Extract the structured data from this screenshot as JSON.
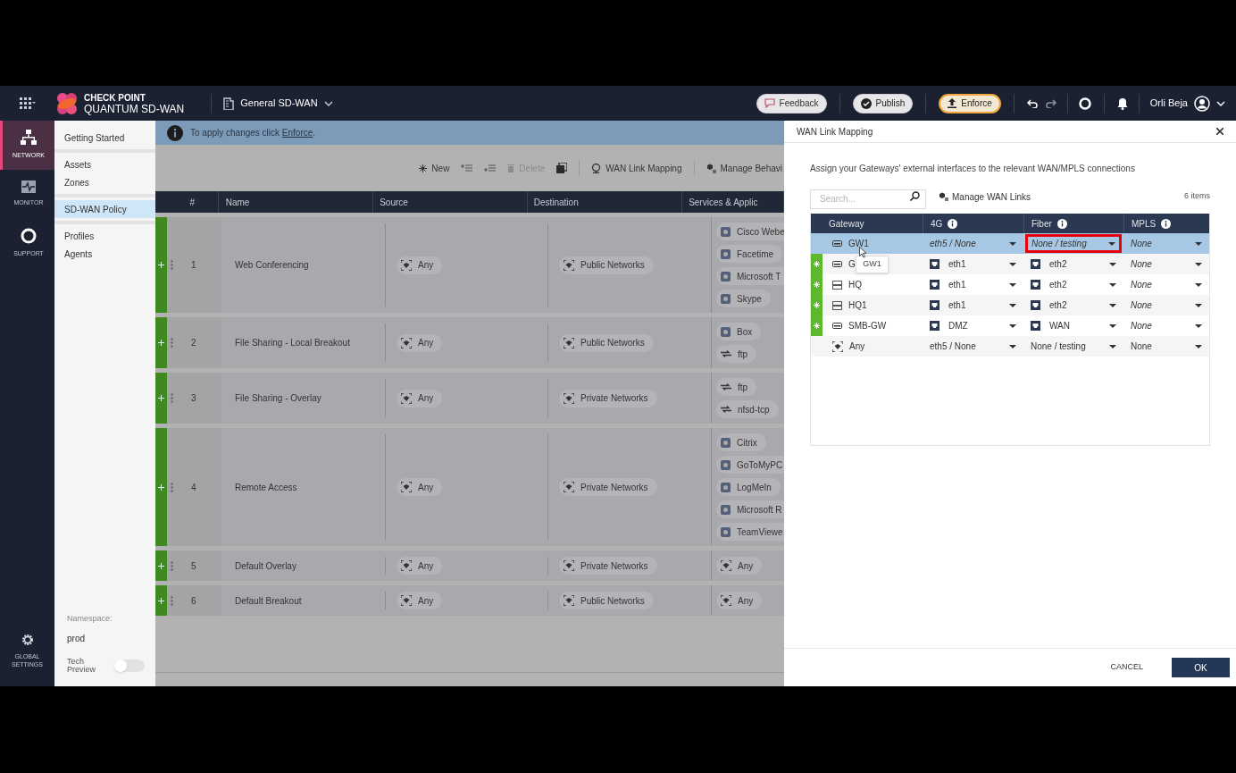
{
  "top_bar": {
    "brand_line1": "CHECK POINT",
    "brand_line2": "QUANTUM SD-WAN",
    "policy_selector": "General SD-WAN",
    "buttons": [
      {
        "kind": "feedback",
        "label": "Feedback"
      },
      {
        "kind": "publish",
        "label": "Publish"
      },
      {
        "kind": "enforce",
        "label": "Enforce"
      }
    ],
    "user": "Orli Beja"
  },
  "rail": {
    "items": [
      {
        "kind": "network",
        "label": "NETWORK",
        "selected": true
      },
      {
        "kind": "monitor",
        "label": "MONITOR",
        "selected": false
      },
      {
        "kind": "support",
        "label": "SUPPORT",
        "selected": false
      }
    ],
    "settings_label": "GLOBAL SETTINGS"
  },
  "subnav": {
    "groups": [
      [
        {
          "label": "Getting Started",
          "selected": false
        }
      ],
      [
        {
          "label": "Assets",
          "selected": false
        },
        {
          "label": "Zones",
          "selected": false
        }
      ],
      [
        {
          "label": "SD-WAN Policy",
          "selected": true
        }
      ],
      [
        {
          "label": "Profiles",
          "selected": false
        },
        {
          "label": "Agents",
          "selected": false
        }
      ]
    ],
    "namespace_label": "Namespace:",
    "namespace": "prod",
    "tech_preview_label": "Tech Preview",
    "tech_preview_on": false
  },
  "banner": {
    "text_before": "To apply changes click ",
    "link": "Enforce",
    "text_after": "."
  },
  "toolbar": [
    {
      "kind": "new",
      "label": "New",
      "disabled": false
    },
    {
      "kind": "add-above",
      "disabled": false
    },
    {
      "kind": "add-below",
      "disabled": false
    },
    {
      "kind": "delete",
      "label": "Delete",
      "disabled": true
    },
    {
      "kind": "clone",
      "disabled": false
    },
    {
      "kind": "separator"
    },
    {
      "kind": "wan",
      "label": "WAN Link Mapping",
      "disabled": false
    },
    {
      "kind": "separator"
    },
    {
      "kind": "behavior",
      "label": "Manage Behavi",
      "disabled": false
    }
  ],
  "policy_table": {
    "columns": [
      "#",
      "Name",
      "Source",
      "Destination",
      "Services & Applic"
    ],
    "rows": [
      {
        "new": true,
        "number": "1",
        "name": "Web Conferencing",
        "source": "Any",
        "destination": "Public Networks",
        "services": [
          {
            "kind": "app",
            "label": "Cisco Webe"
          },
          {
            "kind": "app",
            "label": "Facetime"
          },
          {
            "kind": "app",
            "label": "Microsoft T"
          },
          {
            "kind": "app",
            "label": "Skype"
          }
        ]
      },
      {
        "new": true,
        "number": "2",
        "name": "File Sharing - Local Breakout",
        "source": "Any",
        "destination": "Public Networks",
        "services": [
          {
            "kind": "app",
            "label": "Box"
          },
          {
            "kind": "service",
            "label": "ftp"
          }
        ]
      },
      {
        "new": true,
        "number": "3",
        "name": "File Sharing - Overlay",
        "source": "Any",
        "destination": "Private Networks",
        "services": [
          {
            "kind": "service",
            "label": "ftp"
          },
          {
            "kind": "service",
            "label": "nfsd-tcp"
          }
        ]
      },
      {
        "new": true,
        "number": "4",
        "name": "Remote Access",
        "source": "Any",
        "destination": "Private Networks",
        "services": [
          {
            "kind": "app",
            "label": "Citrix"
          },
          {
            "kind": "app",
            "label": "GoToMyPC"
          },
          {
            "kind": "app",
            "label": "LogMeIn"
          },
          {
            "kind": "app",
            "label": "Microsoft R"
          },
          {
            "kind": "app",
            "label": "TeamViewe"
          }
        ]
      },
      {
        "new": true,
        "number": "5",
        "name": "Default Overlay",
        "source": "Any",
        "destination": "Private Networks",
        "services": [
          {
            "kind": "any",
            "label": "Any"
          }
        ]
      },
      {
        "new": true,
        "number": "6",
        "name": "Default Breakout",
        "source": "Any",
        "destination": "Public Networks",
        "services": [
          {
            "kind": "any",
            "label": "Any"
          }
        ]
      }
    ]
  },
  "panel": {
    "title": "WAN Link Mapping",
    "description": "Assign your Gateways' external interfaces to the relevant WAN/MPLS connections",
    "search_placeholder": "Search...",
    "manage_button": "Manage WAN Links",
    "count": "6 items",
    "columns": [
      {
        "label": "Gateway",
        "info": false
      },
      {
        "label": "4G",
        "info": true
      },
      {
        "label": "Fiber",
        "info": true
      },
      {
        "label": "MPLS",
        "info": true
      }
    ],
    "rows": [
      {
        "selected": true,
        "new": false,
        "kind": "gateway",
        "gateway": "GW1",
        "cells": [
          {
            "text": "eth5 / None",
            "italic": true,
            "interface": false,
            "highlighted": false
          },
          {
            "text": "None / testing",
            "italic": true,
            "interface": false,
            "highlighted": true
          },
          {
            "text": "None",
            "italic": true,
            "interface": false,
            "highlighted": false
          }
        ]
      },
      {
        "selected": false,
        "new": true,
        "kind": "gateway",
        "gateway": "G",
        "cells": [
          {
            "text": "eth1",
            "italic": false,
            "interface": true,
            "highlighted": false
          },
          {
            "text": "eth2",
            "italic": false,
            "interface": true,
            "highlighted": false
          },
          {
            "text": "None",
            "italic": true,
            "interface": false,
            "highlighted": false
          }
        ]
      },
      {
        "selected": false,
        "new": true,
        "kind": "cluster",
        "gateway": "HQ",
        "cells": [
          {
            "text": "eth1",
            "italic": false,
            "interface": true,
            "highlighted": false
          },
          {
            "text": "eth2",
            "italic": false,
            "interface": true,
            "highlighted": false
          },
          {
            "text": "None",
            "italic": true,
            "interface": false,
            "highlighted": false
          }
        ]
      },
      {
        "selected": false,
        "new": true,
        "kind": "cluster",
        "gateway": "HQ1",
        "cells": [
          {
            "text": "eth1",
            "italic": false,
            "interface": true,
            "highlighted": false
          },
          {
            "text": "eth2",
            "italic": false,
            "interface": true,
            "highlighted": false
          },
          {
            "text": "None",
            "italic": true,
            "interface": false,
            "highlighted": false
          }
        ]
      },
      {
        "selected": false,
        "new": true,
        "kind": "gateway",
        "gateway": "SMB-GW",
        "cells": [
          {
            "text": "DMZ",
            "italic": false,
            "interface": true,
            "highlighted": false
          },
          {
            "text": "WAN",
            "italic": false,
            "interface": true,
            "highlighted": false
          },
          {
            "text": "None",
            "italic": true,
            "interface": false,
            "highlighted": false
          }
        ]
      },
      {
        "selected": false,
        "new": false,
        "kind": "any",
        "gateway": "Any",
        "cells": [
          {
            "text": "eth5 / None",
            "italic": false,
            "interface": false,
            "highlighted": false
          },
          {
            "text": "None / testing",
            "italic": false,
            "interface": false,
            "highlighted": false
          },
          {
            "text": "None",
            "italic": false,
            "interface": false,
            "highlighted": false
          }
        ]
      }
    ],
    "tooltip": "GW1",
    "buttons": {
      "cancel": "CANCEL",
      "ok": "OK"
    }
  }
}
